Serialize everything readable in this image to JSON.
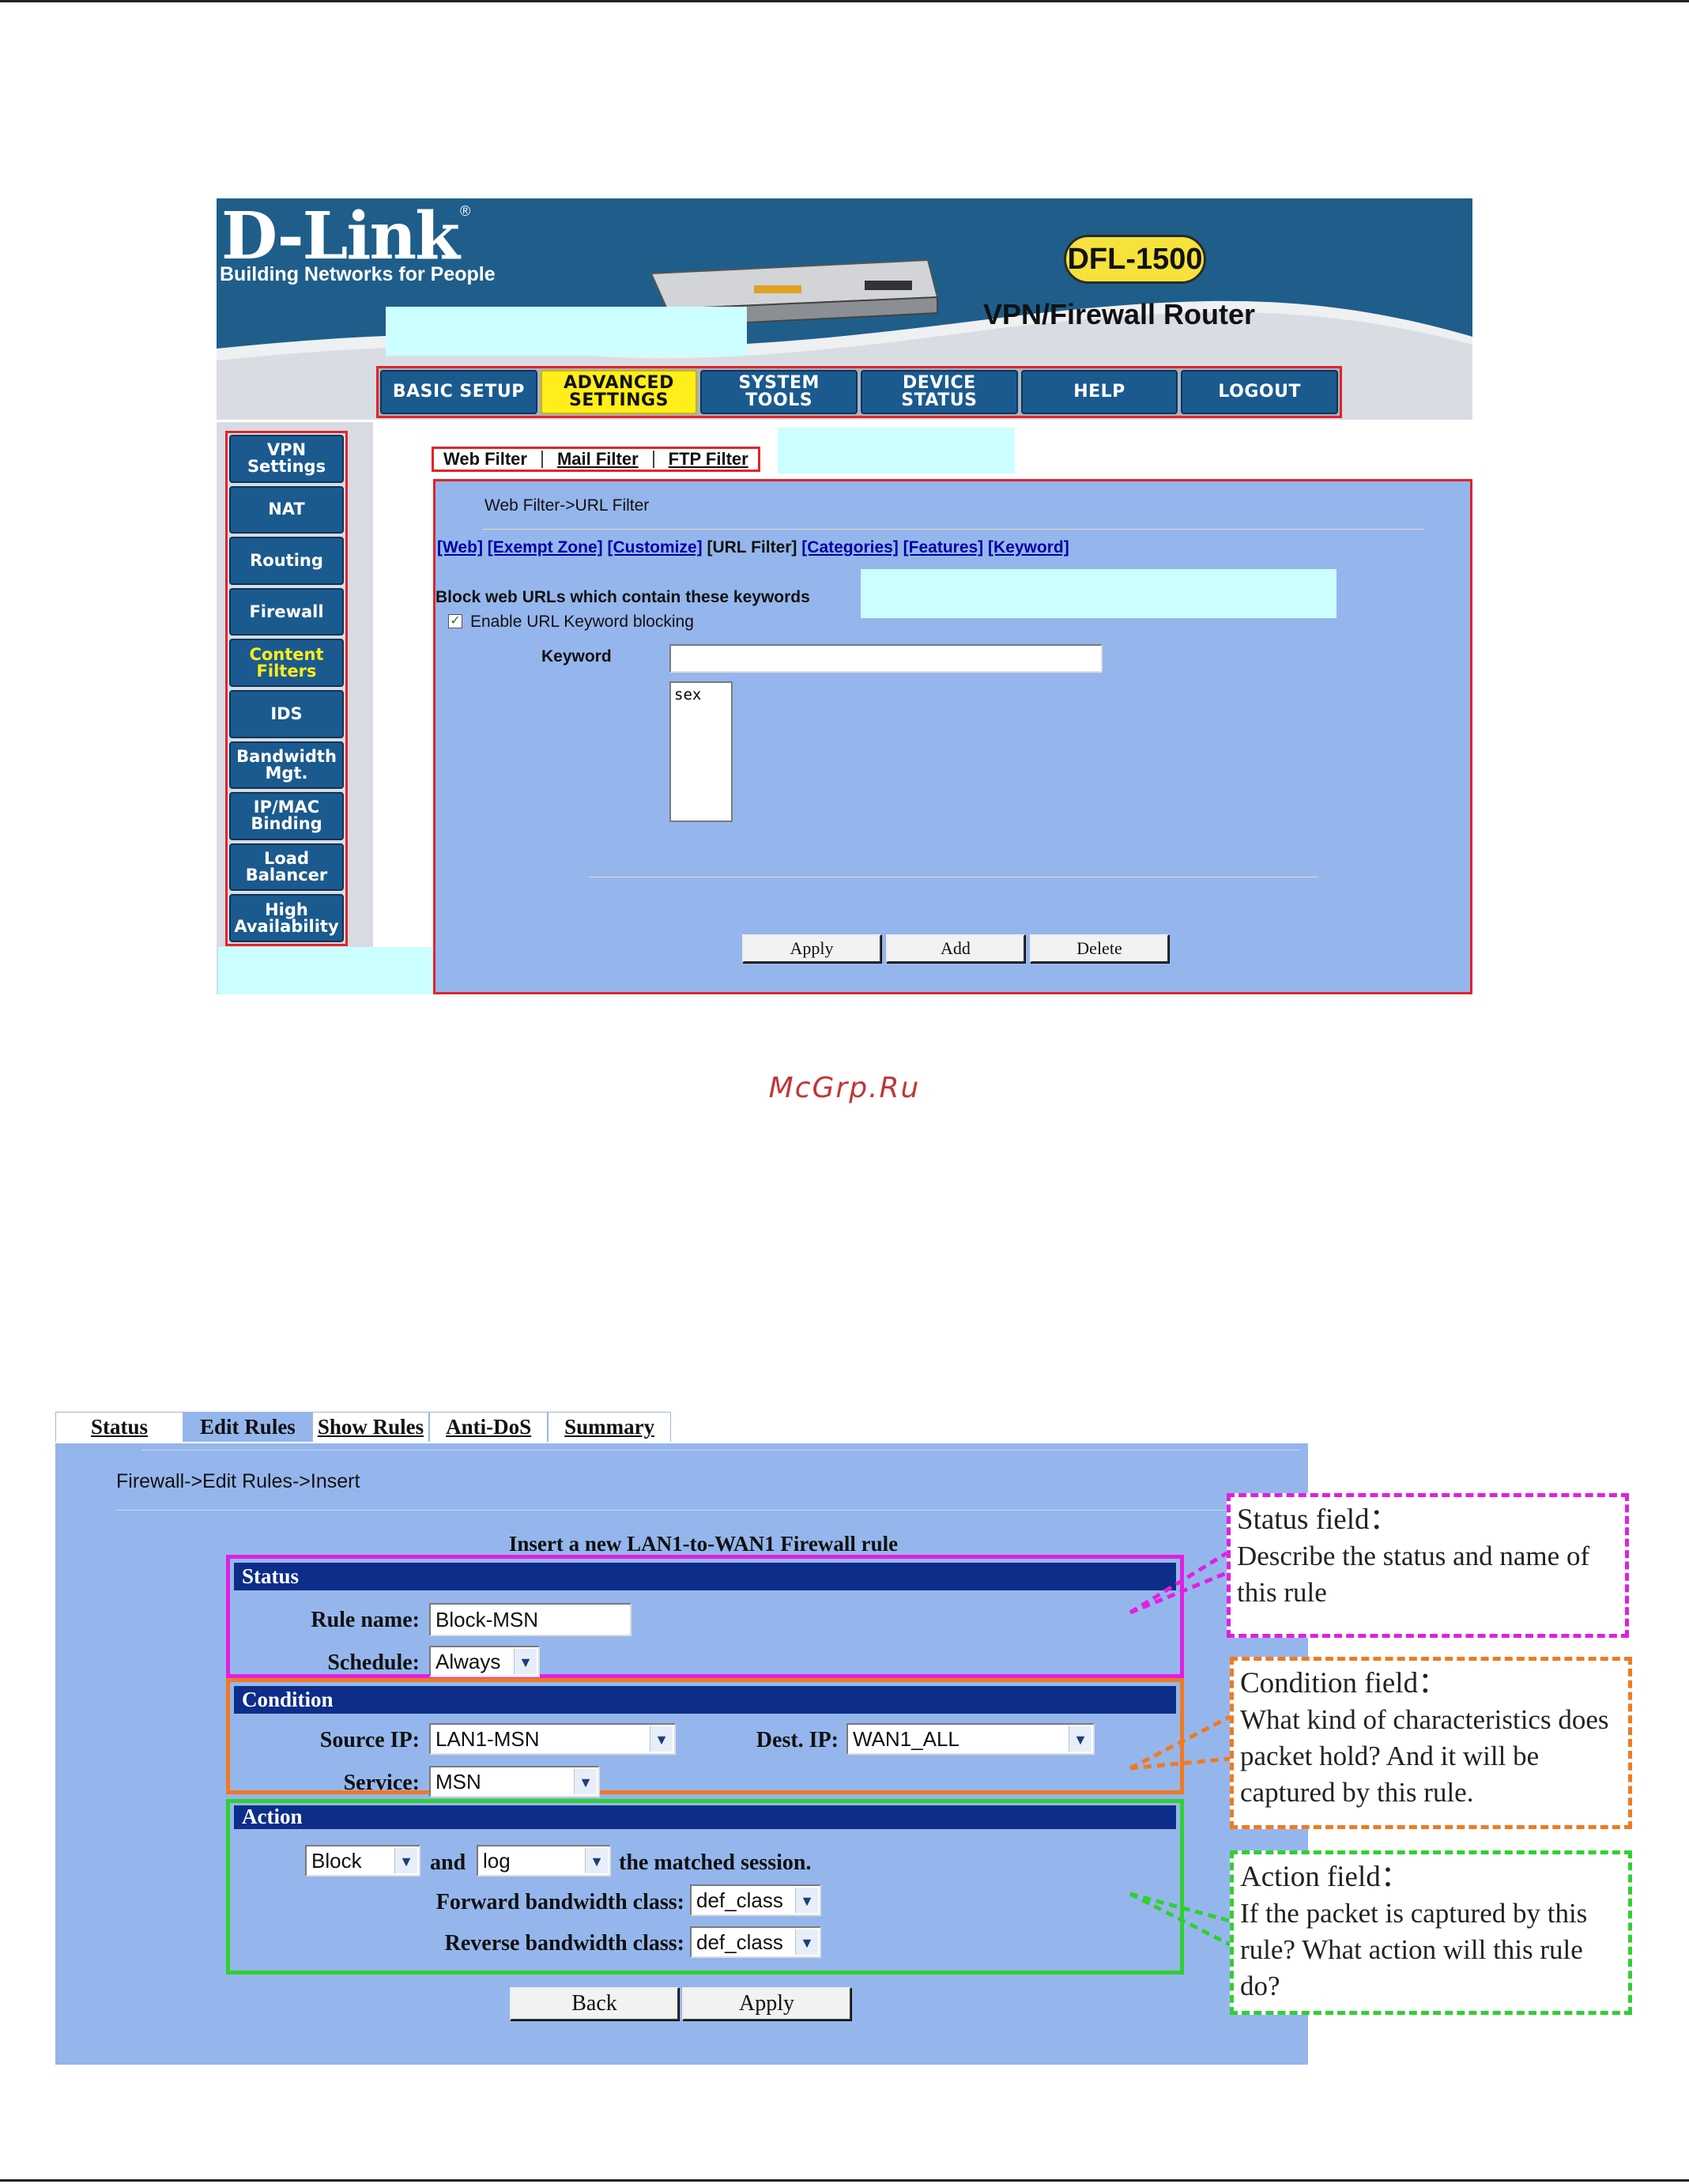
{
  "brand": {
    "logo": "D-Link",
    "tagline": "Building Networks for People",
    "model": "DFL-1500",
    "product": "VPN/Firewall Router"
  },
  "top_nav": [
    {
      "label": "BASIC SETUP"
    },
    {
      "label": "ADVANCED SETTINGS"
    },
    {
      "label": "SYSTEM TOOLS"
    },
    {
      "label": "DEVICE STATUS"
    },
    {
      "label": "HELP"
    },
    {
      "label": "LOGOUT"
    }
  ],
  "side_nav": [
    {
      "label": "VPN Settings"
    },
    {
      "label": "NAT"
    },
    {
      "label": "Routing"
    },
    {
      "label": "Firewall"
    },
    {
      "label": "Content Filters"
    },
    {
      "label": "IDS"
    },
    {
      "label": "Bandwidth Mgt."
    },
    {
      "label": "IP/MAC Binding"
    },
    {
      "label": "Load Balancer"
    },
    {
      "label": "High Availability"
    }
  ],
  "filter_tabs": [
    {
      "label": "Web Filter"
    },
    {
      "label": "Mail Filter"
    },
    {
      "label": "FTP Filter"
    }
  ],
  "web_filter": {
    "breadcrumb": "Web Filter->URL Filter",
    "sublinks": {
      "web": "[Web]",
      "exempt": "[Exempt Zone]",
      "customize": "[Customize]",
      "url": "[URL Filter]",
      "categories": "[Categories]",
      "features": "[Features]",
      "keyword": "[Keyword]"
    },
    "section_title": "Block web URLs which contain these keywords",
    "enable_label": "Enable URL Keyword blocking",
    "enable_checked": true,
    "keyword_label": "Keyword",
    "keyword_value": "",
    "keyword_list": "sex",
    "buttons": {
      "apply": "Apply",
      "add": "Add",
      "delete": "Delete"
    }
  },
  "watermark": "McGrp.Ru",
  "firewall": {
    "tabs": [
      {
        "label": "Status"
      },
      {
        "label": "Edit Rules"
      },
      {
        "label": "Show Rules"
      },
      {
        "label": "Anti-DoS"
      },
      {
        "label": "Summary"
      }
    ],
    "breadcrumb": "Firewall->Edit Rules->Insert",
    "title": "Insert a new LAN1-to-WAN1 Firewall rule",
    "status": {
      "header": "Status",
      "rule_name_label": "Rule name:",
      "rule_name_value": "Block-MSN",
      "schedule_label": "Schedule:",
      "schedule_value": "Always"
    },
    "condition": {
      "header": "Condition",
      "source_ip_label": "Source IP:",
      "source_ip_value": "LAN1-MSN",
      "dest_ip_label": "Dest. IP:",
      "dest_ip_value": "WAN1_ALL",
      "service_label": "Service:",
      "service_value": "MSN"
    },
    "action": {
      "header": "Action",
      "action_value": "Block",
      "and_label": "and",
      "log_value": "log",
      "matched_label": "the matched session.",
      "forward_label": "Forward bandwidth class:",
      "forward_value": "def_class",
      "reverse_label": "Reverse bandwidth class:",
      "reverse_value": "def_class"
    },
    "buttons": {
      "back": "Back",
      "apply": "Apply"
    }
  },
  "callouts": {
    "status": {
      "title": "Status field：",
      "text": "Describe the status and name of this rule",
      "color": "#e020e0"
    },
    "condition": {
      "title": "Condition field：",
      "text": "What kind of characteristics does packet hold? And it will be captured by this rule.",
      "color": "#f07a20"
    },
    "action": {
      "title": "Action field：",
      "text": "If the packet is captured by this rule? What action will this rule do?",
      "color": "#30d030"
    }
  },
  "colors": {
    "panel_blue": "#95b6ec",
    "nav_blue": "#1b5a8f",
    "highlight_red": "#e0242b",
    "section_navy": "#0c2e8a"
  }
}
